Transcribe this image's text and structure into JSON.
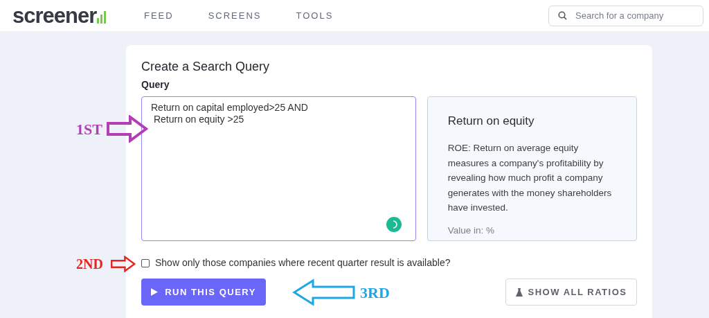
{
  "header": {
    "logo": "screener",
    "nav": [
      {
        "label": "FEED"
      },
      {
        "label": "SCREENS"
      },
      {
        "label": "TOOLS"
      }
    ],
    "search": {
      "placeholder": "Search for a company"
    }
  },
  "card": {
    "title": "Create a Search Query",
    "query_label": "Query",
    "query": "Return on capital employed>25 AND\n Return on equity >25",
    "info": {
      "title": "Return on equity",
      "description": "ROE: Return on average equity measures a company's profitability by revealing how much profit a company generates with the money shareholders have invested.",
      "unit": "Value in: %"
    },
    "checkbox": {
      "label": "Show only those companies where recent quarter result is available?",
      "checked": false
    },
    "run_button": "RUN THIS QUERY",
    "ratios_button": "SHOW ALL RATIOS"
  },
  "annotations": [
    {
      "label": "1ST",
      "color": "#b23db5"
    },
    {
      "label": "2ND",
      "color": "#e8231f"
    },
    {
      "label": "3RD",
      "color": "#1ea7e4"
    }
  ]
}
